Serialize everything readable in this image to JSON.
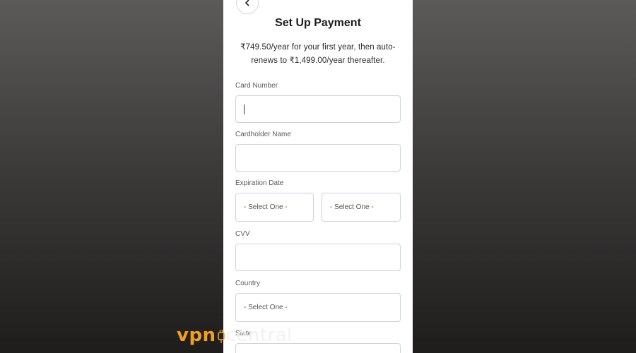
{
  "page": {
    "title": "Set Up Payment",
    "subtitle": "₹749.50/year for your first year, then auto-renews to ₹1,499.00/year thereafter."
  },
  "form": {
    "card_number_label": "Card Number",
    "cardholder_name_label": "Cardholder Name",
    "expiration_label": "Expiration Date",
    "expiration_month_value": "- Select One -",
    "expiration_year_value": "- Select One -",
    "cvv_label": "CVV",
    "country_label": "Country",
    "country_value": "- Select One -",
    "state_label": "State"
  },
  "watermark": {
    "brand_part1": "vpn",
    "brand_part2": "central",
    "accent_color": "#f0a020"
  },
  "icons": {
    "back": "chevron-left-icon"
  }
}
